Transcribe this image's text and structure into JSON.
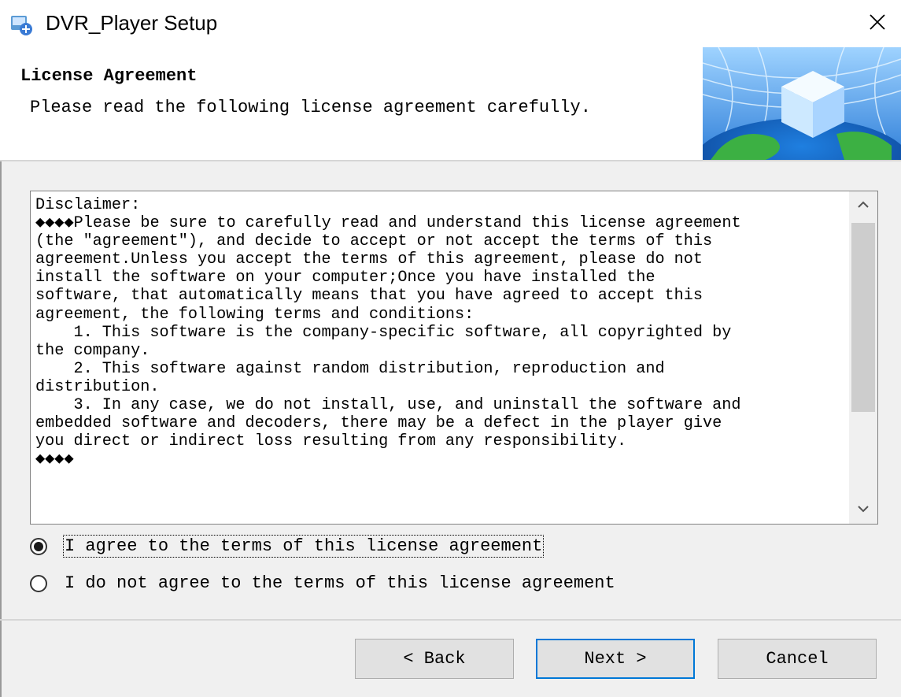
{
  "window": {
    "title": "DVR_Player Setup",
    "close_glyph": "✕"
  },
  "header": {
    "title": "License Agreement",
    "subtitle": "Please read the following license agreement carefully."
  },
  "license": {
    "text": "Disclaimer:\n◆◆◆◆Please be sure to carefully read and understand this license agreement\n(the \"agreement\"), and decide to accept or not accept the terms of this\nagreement.Unless you accept the terms of this agreement, please do not\ninstall the software on your computer;Once you have installed the\nsoftware, that automatically means that you have agreed to accept this\nagreement, the following terms and conditions:\n    1. This software is the company-specific software, all copyrighted by\nthe company.\n    2. This software against random distribution, reproduction and\ndistribution.\n    3. In any case, we do not install, use, and uninstall the software and\nembedded software and decoders, there may be a defect in the player give\nyou direct or indirect loss resulting from any responsibility.\n◆◆◆◆"
  },
  "options": {
    "agree": {
      "label": "I agree to the terms of this license agreement",
      "selected": true
    },
    "disagree": {
      "label": "I do not agree to the terms of this license agreement",
      "selected": false
    }
  },
  "buttons": {
    "back": "< Back",
    "next": "Next >",
    "cancel": "Cancel"
  },
  "colors": {
    "accent": "#0078d7"
  }
}
